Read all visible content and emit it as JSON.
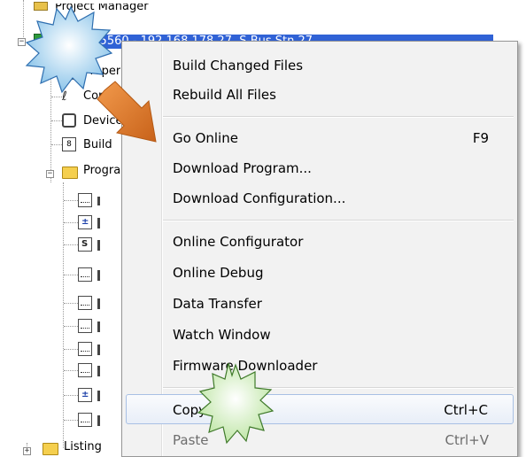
{
  "tree": {
    "root_label": "Project Manager",
    "device_label": "PCD3.M5560 - 192.168.178.27, S-Bus Stn 27",
    "items": [
      {
        "label": "Properties",
        "icon": "properties-icon"
      },
      {
        "label": "Configuration",
        "icon": "configuration-icon"
      },
      {
        "label": "Device",
        "icon": "device-icon"
      },
      {
        "label": "Build",
        "icon": "build-icon"
      },
      {
        "label": "Program Files",
        "icon": "folder-icon"
      },
      {
        "label": "Listing",
        "icon": "folder-icon"
      }
    ]
  },
  "menu": {
    "items": [
      {
        "label": "Build Changed Files",
        "shortcut": ""
      },
      {
        "label": "Rebuild All Files",
        "shortcut": ""
      },
      {
        "label": "Go Online",
        "shortcut": "F9"
      },
      {
        "label": "Download Program...",
        "shortcut": ""
      },
      {
        "label": "Download Configuration...",
        "shortcut": ""
      },
      {
        "label": "Online Configurator",
        "shortcut": ""
      },
      {
        "label": "Online Debug",
        "shortcut": ""
      },
      {
        "label": "Data Transfer",
        "shortcut": ""
      },
      {
        "label": "Watch Window",
        "shortcut": ""
      },
      {
        "label": "Firmware Downloader",
        "shortcut": ""
      },
      {
        "label": "Copy",
        "shortcut": "Ctrl+C"
      },
      {
        "label": "Paste",
        "shortcut": "Ctrl+V"
      }
    ],
    "highlighted_item": "Copy",
    "disabled_item": "Paste"
  },
  "annotations": {
    "arrow_color": "#d9761e",
    "starburst_blue": "#9fd0ef",
    "starburst_green": "#d7f0c4"
  }
}
